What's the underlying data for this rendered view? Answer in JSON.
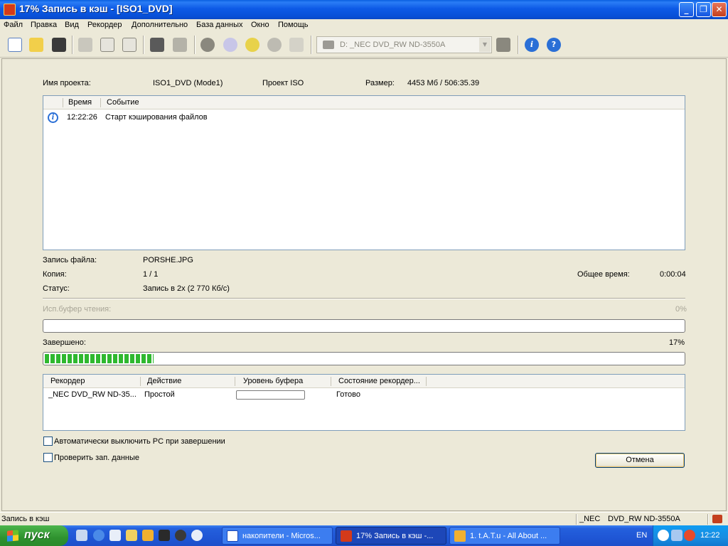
{
  "window": {
    "title": "17% Запись в кэш - [ISO1_DVD]",
    "controls": [
      "_",
      "❐",
      "✕"
    ]
  },
  "menu": [
    "Файл",
    "Правка",
    "Вид",
    "Рекордер",
    "Дополнительно",
    "База данных",
    "Окно",
    "Помощь"
  ],
  "toolbar": {
    "icons": [
      "new-icon",
      "open-icon",
      "save-icon",
      "cut-icon",
      "copy-icon",
      "paste-icon",
      "edit-icon",
      "tools-icon",
      "burn-icon",
      "copy-disc-icon",
      "disc-info-icon",
      "eject-icon",
      "folder-icon",
      "drive-info-icon",
      "info-icon",
      "help-icon"
    ],
    "drive": "D: _NEC     DVD_RW ND-3550A"
  },
  "project": {
    "name_label": "Имя проекта:",
    "name_value": "ISO1_DVD (Mode1)",
    "type": "Проект ISO",
    "size_label": "Размер:",
    "size_value": "4453 Мб   /   506:35.39"
  },
  "log": {
    "columns": [
      "Время",
      "Событие"
    ],
    "rows": [
      {
        "time": "12:22:26",
        "event": "Старт кэширования файлов",
        "icon": "info-icon"
      }
    ]
  },
  "status": {
    "file_label": "Запись файла:",
    "file_value": "PORSHE.JPG",
    "copy_label": "Копия:",
    "copy_value": "1 / 1",
    "total_time_label": "Общее время:",
    "total_time_value": "0:00:04",
    "state_label": "Статус:",
    "state_value": "Запись в 2x (2 770 Кб/с)"
  },
  "read_buffer": {
    "label": "Исп.буфер чтения:",
    "percent_text": "0%",
    "fraction": 0.0
  },
  "completed": {
    "label": "Завершено:",
    "percent_text": "17%",
    "fraction": 0.17
  },
  "recorder": {
    "columns": [
      "Рекордер",
      "Действие",
      "Уровень буфера",
      "Состояние рекордер..."
    ],
    "rows": [
      {
        "recorder": "_NEC DVD_RW ND-35...",
        "action": "Простой",
        "buffer_fraction": 0.0,
        "state": "Готово"
      }
    ]
  },
  "options": {
    "auto_shutdown_label": "Автоматически выключить PC при завершении",
    "auto_shutdown_checked": false,
    "verify_label": "Проверить зап. данные",
    "verify_checked": false
  },
  "cancel_button": "Отмена",
  "statusbar": {
    "left": "Запись в кэш",
    "device": "_NEC",
    "model": "DVD_RW ND-3550A"
  },
  "taskbar": {
    "start_label": "пуск",
    "tasks": [
      {
        "label": "накопители - Micros...",
        "icon": "word-icon",
        "active": false
      },
      {
        "label": "17% Запись в кэш -...",
        "icon": "nero-icon",
        "active": true
      },
      {
        "label": "1. t.A.T.u - All About ...",
        "icon": "winamp-icon",
        "active": false
      }
    ],
    "lang": "EN",
    "clock": "12:22"
  }
}
